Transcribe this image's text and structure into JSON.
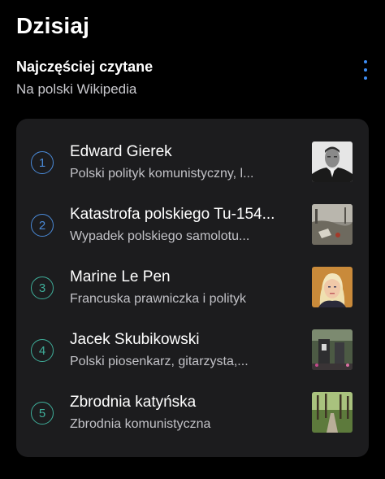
{
  "header": {
    "title": "Dzisiaj"
  },
  "section": {
    "title": "Najczęściej czytane",
    "subtitle": "Na polski Wikipedia"
  },
  "items": [
    {
      "rank": "1",
      "title": "Edward Gierek",
      "description": "Polski polityk komunistyczny, l...",
      "rank_color": "#4a8ad8"
    },
    {
      "rank": "2",
      "title": "Katastrofa polskiego Tu-154...",
      "description": "Wypadek polskiego samolotu...",
      "rank_color": "#4a8ad8"
    },
    {
      "rank": "3",
      "title": "Marine Le Pen",
      "description": "Francuska prawniczka i polityk",
      "rank_color": "#3fae9a"
    },
    {
      "rank": "4",
      "title": "Jacek Skubikowski",
      "description": "Polski piosenkarz, gitarzysta,...",
      "rank_color": "#3fae9a"
    },
    {
      "rank": "5",
      "title": "Zbrodnia katyńska",
      "description": "Zbrodnia komunistyczna",
      "rank_color": "#3fae9a"
    }
  ],
  "icons": {
    "more": "more-vertical-icon",
    "chevron": "chevron-right-icon"
  },
  "colors": {
    "background": "#000000",
    "card": "#1c1c1e",
    "accent": "#3d8df5"
  }
}
